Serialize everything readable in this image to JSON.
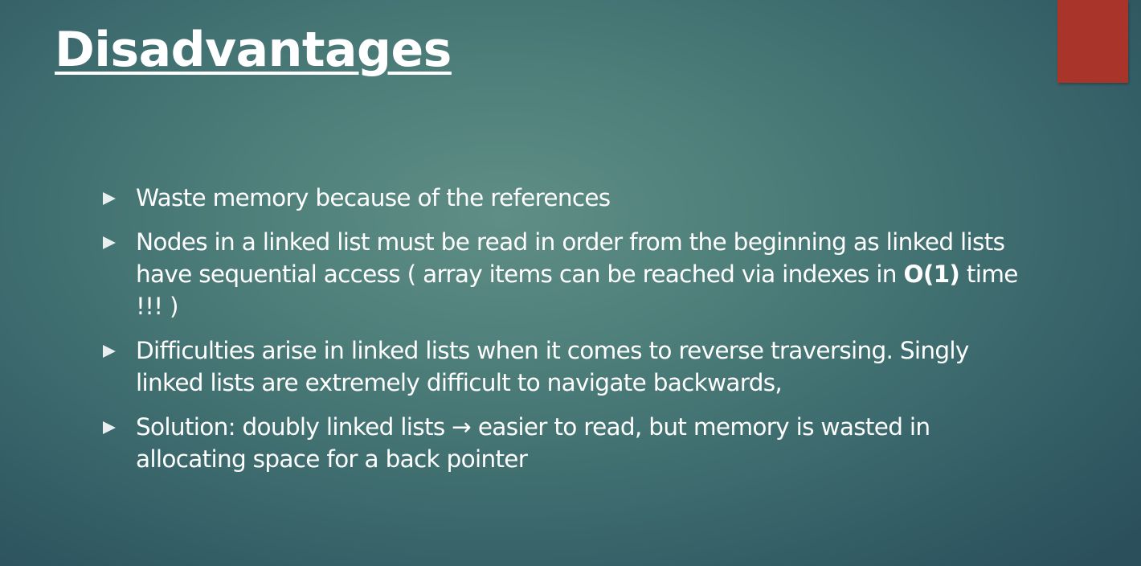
{
  "slide": {
    "title": "Disadvantages",
    "bullets": [
      {
        "text": "Waste memory because of the references"
      },
      {
        "text_before": "Nodes in a linked list must be read in order from the beginning as linked lists have sequential access ( array items can be reached via indexes in ",
        "text_bold": "O(1)",
        "text_after": " time  !!! )"
      },
      {
        "text": "Difficulties arise in linked lists when it comes to reverse traversing. Singly linked lists are extremely difficult to navigate backwards,"
      },
      {
        "text": "Solution:  doubly linked lists → easier to read, but memory is wasted in allocating space for a back pointer"
      }
    ]
  },
  "colors": {
    "background_center": "#5f8e85",
    "background_edge": "#2b505c",
    "accent_block": "#a8342a",
    "text": "#ffffff"
  },
  "icons": {
    "bullet": "triangle-right-icon"
  }
}
